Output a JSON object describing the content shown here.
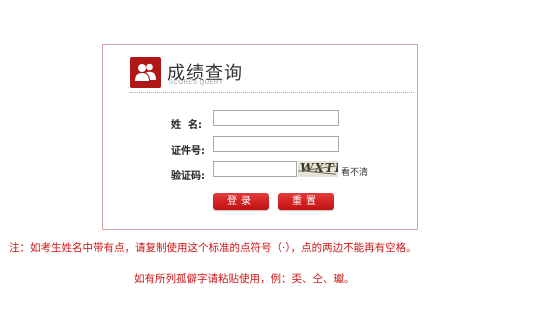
{
  "header": {
    "title": "成绩查询",
    "subtitle": "SCORES QUERY"
  },
  "form": {
    "name_label": "姓  名:",
    "name_value": "",
    "id_label": "证件号:",
    "id_value": "",
    "code_label": "验证码:",
    "code_value": "",
    "captcha_text": "WXTR",
    "refresh_label": "看不清"
  },
  "buttons": {
    "login": "登录",
    "reset": "重置"
  },
  "notes": {
    "line1": "注：如考生姓名中带有点，请复制使用这个标准的点符号（·），点的两边不能再有空格。",
    "line2": "如有所列孤僻字请粘贴使用，例：奀、仝、瓛。"
  },
  "colors": {
    "accent": "#b01818",
    "note_text": "#d01414",
    "panel_border": "#d9a3a3"
  },
  "icons": {
    "logo": "user-group-icon"
  }
}
